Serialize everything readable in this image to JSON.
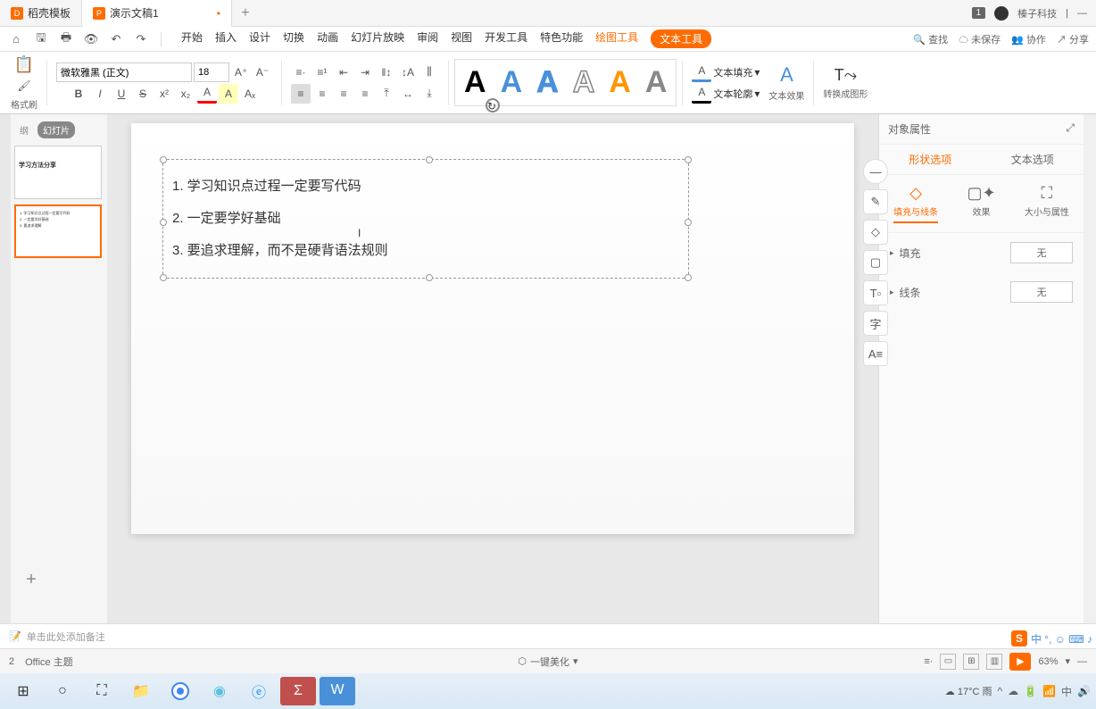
{
  "tabs": [
    {
      "icon": "D",
      "label": "稻壳模板"
    },
    {
      "icon": "P",
      "label": "演示文稿1",
      "modified": "•"
    }
  ],
  "titleRight": {
    "badge": "1",
    "company": "榛子科技"
  },
  "menus": [
    "开始",
    "插入",
    "设计",
    "切换",
    "动画",
    "幻灯片放映",
    "审阅",
    "视图",
    "开发工具",
    "特色功能"
  ],
  "menuHl1": "绘图工具",
  "menuHl2": "文本工具",
  "menuRight": {
    "search": "查找",
    "unsave": "未保存",
    "collab": "协作",
    "share": "分享"
  },
  "formatBrush": "格式刷",
  "font": "微软雅黑 (正文)",
  "fontSize": "18",
  "textFill": "文本填充",
  "textOutline": "文本轮廓",
  "textEffect": "文本效果",
  "convertShape": "转换成图形",
  "thumbTabs": [
    "纲",
    "幻灯片"
  ],
  "thumb1_title": "学习方法分享",
  "slide": {
    "line1": "1. 学习知识点过程一定要写代码",
    "line2": "2. 一定要学好基础",
    "line3": "3. 要追求理解，而不是硬背语法规则"
  },
  "rpanel": {
    "title": "对象属性",
    "tab1": "形状选项",
    "tab2": "文本选项",
    "sub1": "填充与线条",
    "sub2": "效果",
    "sub3": "大小与属性",
    "fill": "填充",
    "fillVal": "无",
    "line": "线条",
    "lineVal": "无"
  },
  "notes": "单击此处添加备注",
  "status": {
    "left": "2",
    "theme": "Office 主题",
    "beautify": "一键美化",
    "zoom": "63%"
  },
  "taskbar": {
    "weather": "17°C 雨"
  },
  "ime": {
    "s": "S",
    "chars": "中 °, ☺ ⌨ ♪"
  }
}
